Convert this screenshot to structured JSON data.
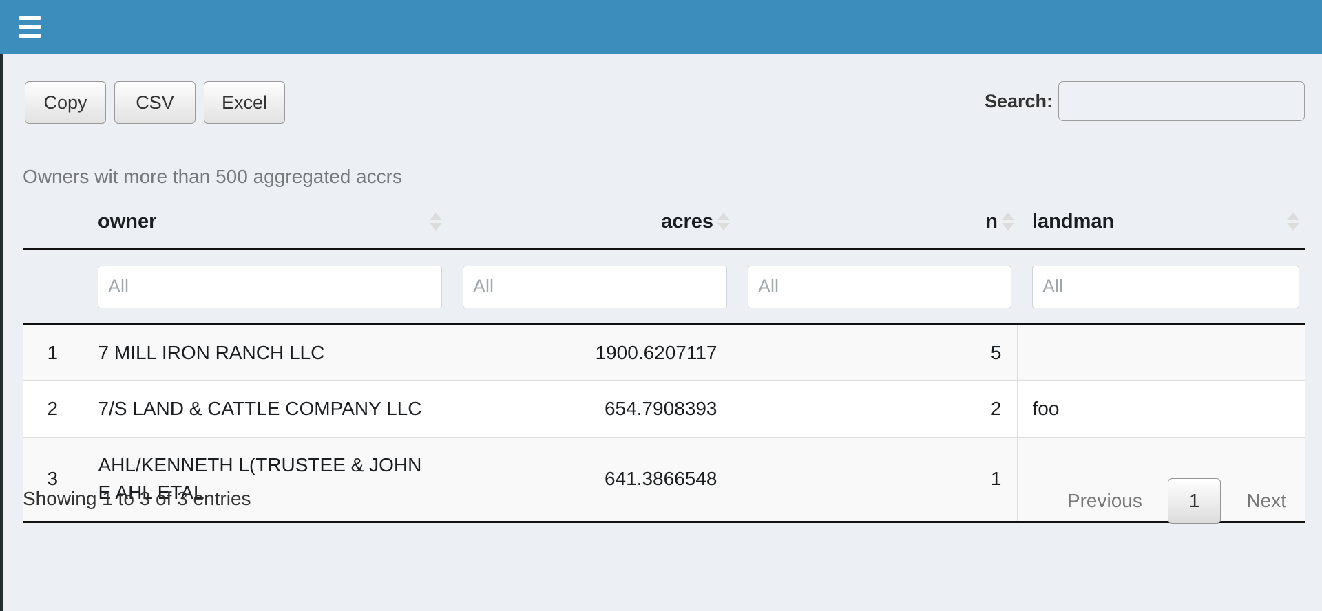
{
  "navbar": {
    "menu_toggle": "toggle-navigation"
  },
  "toolbar": {
    "buttons": [
      {
        "label": "Copy",
        "name": "copy-button"
      },
      {
        "label": "CSV",
        "name": "csv-button"
      },
      {
        "label": "Excel",
        "name": "excel-button"
      }
    ]
  },
  "search": {
    "label": "Search:",
    "value": "",
    "placeholder": ""
  },
  "table": {
    "caption": "Owners wit more than 500 aggregated accrs",
    "columns": [
      {
        "key": "idx",
        "label": "",
        "align": "center",
        "sortable": false
      },
      {
        "key": "owner",
        "label": "owner",
        "align": "left",
        "sortable": true
      },
      {
        "key": "acres",
        "label": "acres",
        "align": "right",
        "sortable": true
      },
      {
        "key": "n",
        "label": "n",
        "align": "right",
        "sortable": true
      },
      {
        "key": "landman",
        "label": "landman",
        "align": "left",
        "sortable": true
      }
    ],
    "filters": [
      {
        "column": "owner",
        "value": "",
        "placeholder": "All"
      },
      {
        "column": "acres",
        "value": "",
        "placeholder": "All"
      },
      {
        "column": "n",
        "value": "",
        "placeholder": "All"
      },
      {
        "column": "landman",
        "value": "",
        "placeholder": "All"
      }
    ],
    "rows": [
      {
        "idx": "1",
        "owner": "7 MILL IRON RANCH LLC",
        "acres": "1900.6207117",
        "n": "5",
        "landman": ""
      },
      {
        "idx": "2",
        "owner": "7/S LAND & CATTLE COMPANY LLC",
        "acres": "654.7908393",
        "n": "2",
        "landman": "foo"
      },
      {
        "idx": "3",
        "owner": "AHL/KENNETH L(TRUSTEE & JOHN E AHL ETAL",
        "acres": "641.3866548",
        "n": "1",
        "landman": ""
      }
    ]
  },
  "footer": {
    "info": "Showing 1 to 3 of 3 entries",
    "previous": "Previous",
    "current_page": "1",
    "next": "Next"
  },
  "colors": {
    "navbar": "#3c8dbc",
    "sidebar": "#222d32",
    "content_bg": "#ecf0f5",
    "row_stripe": "#f9f9f9"
  }
}
